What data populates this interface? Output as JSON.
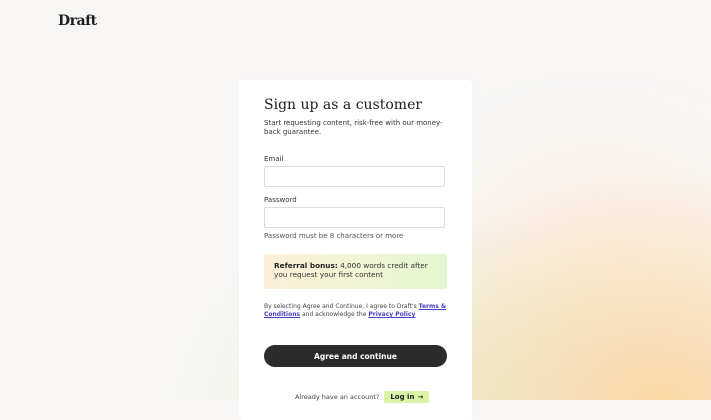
{
  "brand": {
    "logo_text": "Draft"
  },
  "form": {
    "title": "Sign up as a customer",
    "subtitle": "Start requesting content, risk-free with our money-back guarantee.",
    "email_label": "Email",
    "email_value": "",
    "password_label": "Password",
    "password_value": "",
    "password_hint": "Password must be 8 characters or more",
    "referral": {
      "label": "Referral bonus:",
      "text": "4,000 words credit after you request your first content"
    },
    "terms": {
      "prefix": "By selecting Agree and Continue, I agree to Draft's",
      "terms_link": "Terms & Conditions",
      "middle": "and acknowledge the",
      "privacy_link": "Privacy Policy"
    },
    "submit_label": "Agree and continue"
  },
  "login": {
    "prompt": "Already have an account?",
    "button_label": "Log in",
    "arrow_icon": "arrow-right-icon"
  },
  "colors": {
    "button_bg": "#2b2b2b",
    "link": "#4a3fc6",
    "login_bg": "#d9f4a5"
  }
}
